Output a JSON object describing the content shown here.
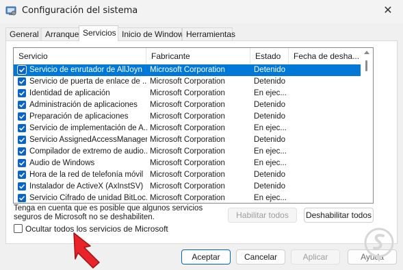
{
  "window": {
    "title": "Configuración del sistema",
    "close_glyph": "✕",
    "icon": "system-config-icon"
  },
  "tabs": [
    {
      "label": "General",
      "active": false
    },
    {
      "label": "Arranque",
      "active": false
    },
    {
      "label": "Servicios",
      "active": true
    },
    {
      "label": "Inicio de Windows",
      "active": false
    },
    {
      "label": "Herramientas",
      "active": false
    }
  ],
  "services_list": {
    "columns": [
      "Servicio",
      "Fabricante",
      "Estado",
      "Fecha de desha..."
    ],
    "rows": [
      {
        "name": "Servicio de enrutador de AllJoyn",
        "maker": "Microsoft Corporation",
        "status": "Detenido",
        "checked": true,
        "selected": true
      },
      {
        "name": "Servicio de puerta de enlace de ...",
        "maker": "Microsoft Corporation",
        "status": "Detenido",
        "checked": true,
        "selected": false
      },
      {
        "name": "Identidad de aplicación",
        "maker": "Microsoft Corporation",
        "status": "En ejec...",
        "checked": true,
        "selected": false
      },
      {
        "name": "Administración de aplicaciones",
        "maker": "Microsoft Corporation",
        "status": "Detenido",
        "checked": true,
        "selected": false
      },
      {
        "name": "Preparación de aplicaciones",
        "maker": "Microsoft Corporation",
        "status": "Detenido",
        "checked": true,
        "selected": false
      },
      {
        "name": "Servicio de implementación de A...",
        "maker": "Microsoft Corporation",
        "status": "En ejec...",
        "checked": true,
        "selected": false
      },
      {
        "name": "Servicio AssignedAccessManager",
        "maker": "Microsoft Corporation",
        "status": "Detenido",
        "checked": true,
        "selected": false
      },
      {
        "name": "Compilador de extremo de audio...",
        "maker": "Microsoft Corporation",
        "status": "En ejec...",
        "checked": true,
        "selected": false
      },
      {
        "name": "Audio de Windows",
        "maker": "Microsoft Corporation",
        "status": "En ejec...",
        "checked": true,
        "selected": false
      },
      {
        "name": "Hora de la red de telefonía móvil",
        "maker": "Microsoft Corporation",
        "status": "Detenido",
        "checked": true,
        "selected": false
      },
      {
        "name": "Instalador de ActiveX (AxInstSV)",
        "maker": "Microsoft Corporation",
        "status": "Detenido",
        "checked": true,
        "selected": false
      },
      {
        "name": "Servicio Cifrado de unidad BitLoc...",
        "maker": "Microsoft Corporation",
        "status": "En ejec...",
        "checked": true,
        "selected": false
      }
    ]
  },
  "note": {
    "line1": "Tenga en cuenta que es posible que algunos servicios",
    "line2": "seguros de Microsoft no se deshabiliten."
  },
  "buttons": {
    "enable_all": "Habilitar todos",
    "disable_all": "Deshabilitar todos",
    "accept": "Aceptar",
    "cancel": "Cancelar",
    "apply": "Aplicar",
    "help": "Ayuda"
  },
  "hide_microsoft": {
    "label": "Ocultar todos los servicios de Microsoft",
    "checked": false
  },
  "colors": {
    "selection": "#0078d7",
    "checkbox": "#0a64c8",
    "arrow": "#e8242a"
  }
}
